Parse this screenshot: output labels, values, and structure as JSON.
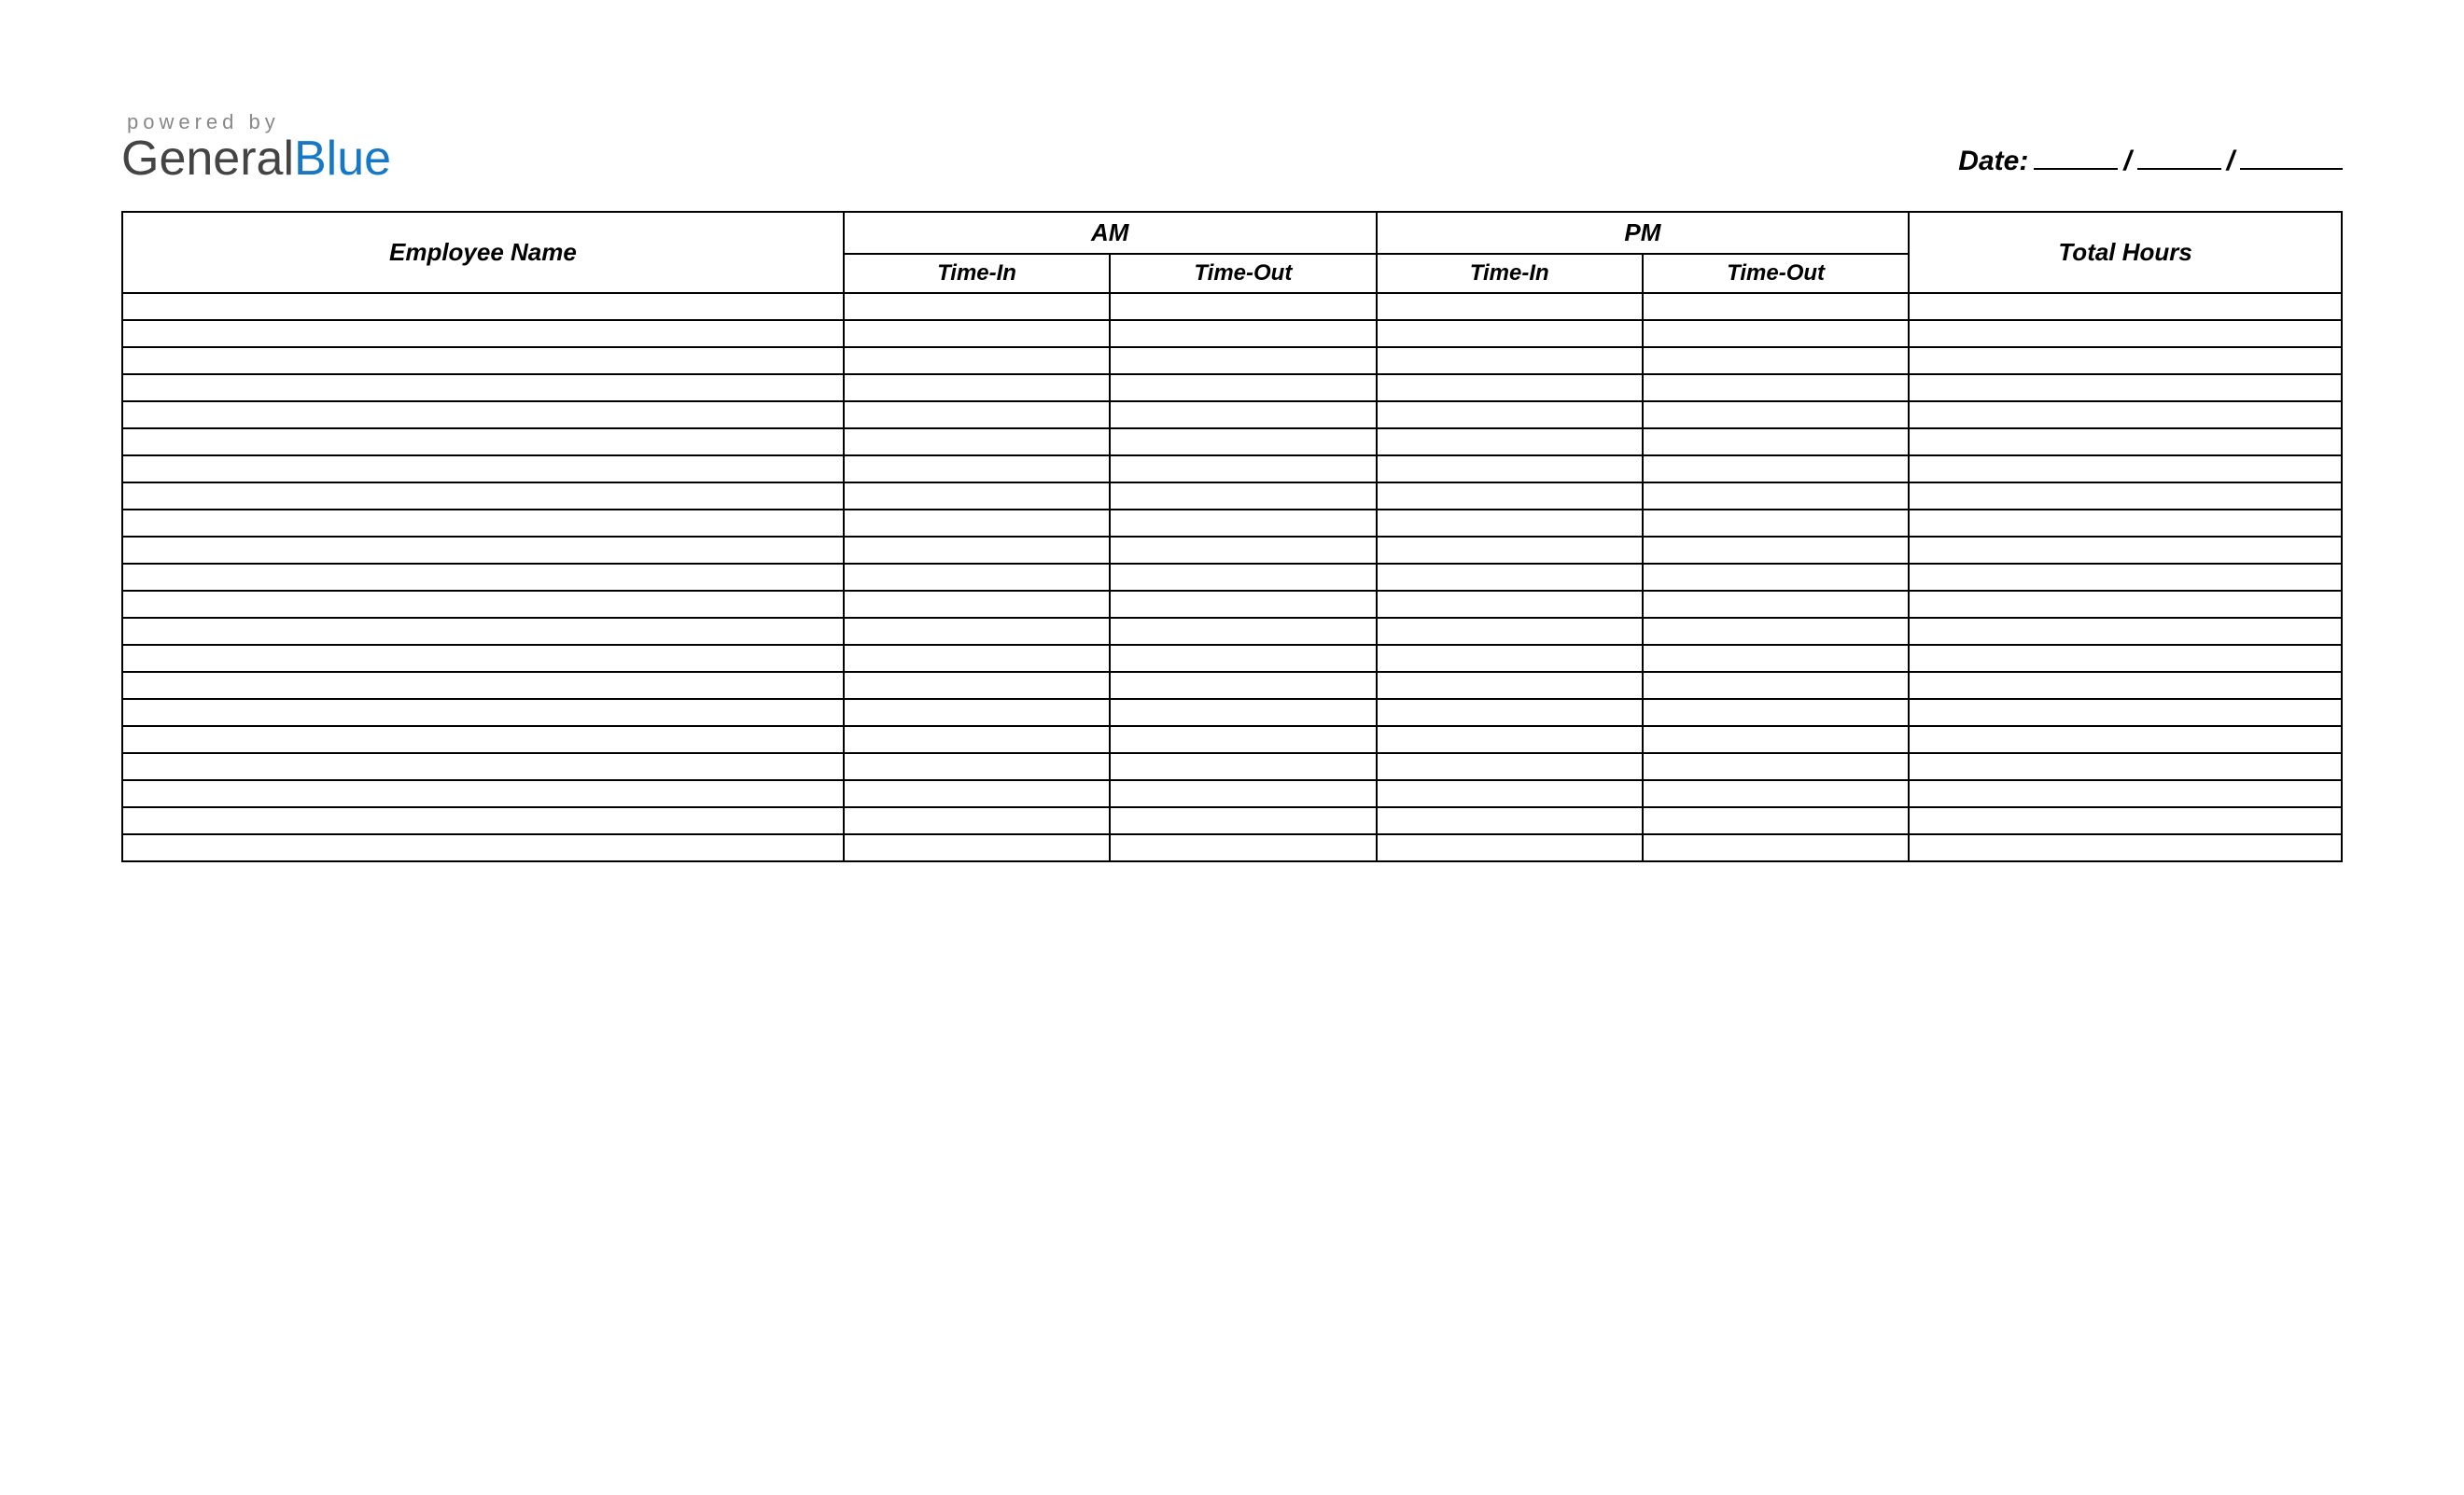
{
  "logo": {
    "powered": "powered by",
    "word1": "General",
    "word2": "Blue"
  },
  "date_label": "Date:",
  "headers": {
    "employee": "Employee Name",
    "am": "AM",
    "pm": "PM",
    "total": "Total Hours",
    "time_in": "Time-In",
    "time_out": "Time-Out"
  },
  "row_count": 21
}
